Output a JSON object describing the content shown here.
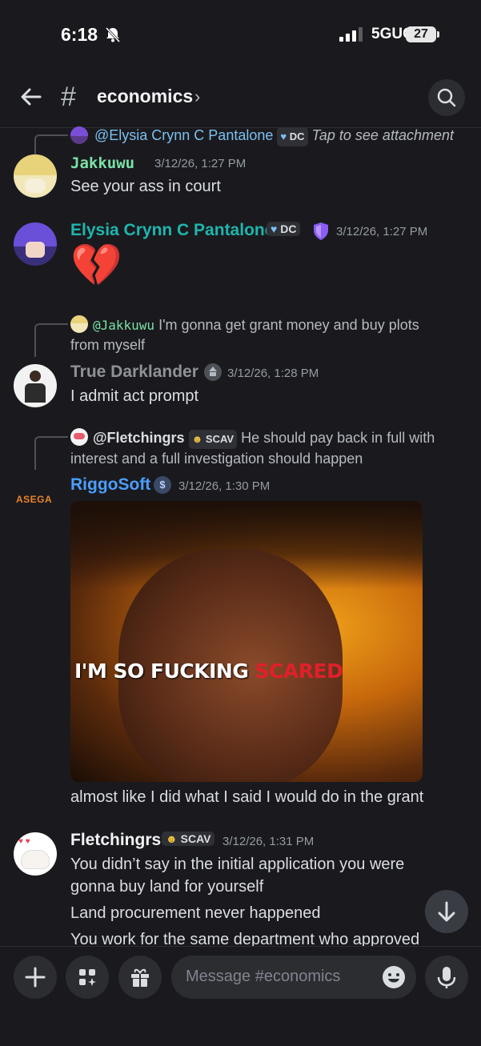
{
  "status_bar": {
    "time": "6:18",
    "network": "5GUC",
    "battery": "27"
  },
  "header": {
    "channel": "economics",
    "chevron": "›"
  },
  "messages": [
    {
      "reply_mention": "@Elysia Crynn C Pantalone",
      "reply_tag": "DC",
      "reply_text": "Tap to see attachment"
    },
    {
      "author": "Jakkuwu",
      "timestamp": "3/12/26, 1:27 PM",
      "text": "See your ass in court"
    },
    {
      "author": "Elysia Crynn C Pantalone",
      "tag": "DC",
      "timestamp": "3/12/26, 1:27 PM",
      "emoji": "💔"
    },
    {
      "reply_mention": "@Jakkuwu",
      "reply_text_1": "I'm gonna get grant money and buy plots",
      "reply_text_2": "from myself",
      "author": "True Darklander",
      "timestamp": "3/12/26, 1:28 PM",
      "text": "I admit act prompt"
    },
    {
      "reply_mention": "@Fletchingrs",
      "reply_tag": "SCAV",
      "reply_text_1": "He should pay back in full with",
      "reply_text_2": "interest and a full investigation should happen",
      "author": "RiggoSoft",
      "avatar_text": "ASEGA",
      "timestamp": "3/12/26, 1:30 PM",
      "image_caption_white": "I'M SO FUCKING ",
      "image_caption_red": "SCARED",
      "text": "almost like I did what I said I would do in the grant"
    },
    {
      "author": "Fletchingrs",
      "tag": "SCAV",
      "timestamp": "3/12/26, 1:31 PM",
      "line1": "You didn’t say in the initial application you were",
      "line2": "gonna buy land for yourself",
      "line3": "Land procurement never happened",
      "line4": "You work for the same department who approved"
    }
  ],
  "composer": {
    "placeholder": "Message #economics"
  },
  "colors": {
    "background": "#1a1a1e",
    "jakkuwu": "#7be0a6",
    "elysia": "#1fb5ad",
    "darklander": "#8e9297",
    "riggosoft": "#4a9eff",
    "fletchingrs": "#f2f3f5",
    "mention": "#7cc0f0"
  }
}
